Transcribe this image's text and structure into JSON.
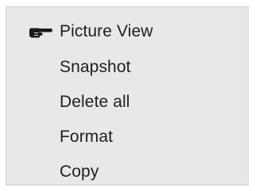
{
  "menu": {
    "items": [
      {
        "label": "Picture View",
        "selected": true,
        "icon": "pointing-hand-icon"
      },
      {
        "label": "Snapshot",
        "selected": false
      },
      {
        "label": "Delete all",
        "selected": false
      },
      {
        "label": "Format",
        "selected": false
      },
      {
        "label": "Copy",
        "selected": false
      }
    ]
  }
}
